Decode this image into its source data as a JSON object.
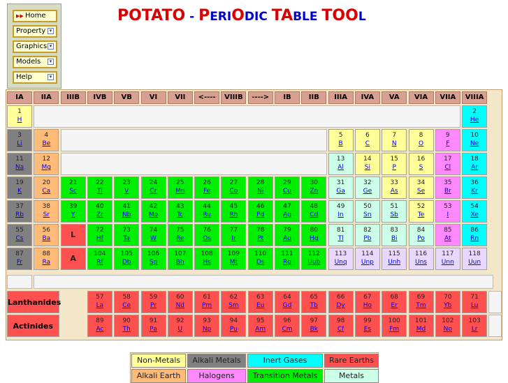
{
  "menu": {
    "home": "Home",
    "items": [
      "Property",
      "Graphics",
      "Models",
      "Help"
    ]
  },
  "title": [
    {
      "t": "POTATO",
      "c": "r",
      "big": true
    },
    {
      "t": " - ",
      "c": "b"
    },
    {
      "t": "P",
      "c": "r",
      "big": true
    },
    {
      "t": "ERI",
      "c": "b"
    },
    {
      "t": "O",
      "c": "r",
      "big": true
    },
    {
      "t": "DIC ",
      "c": "b"
    },
    {
      "t": "TA",
      "c": "r",
      "big": true
    },
    {
      "t": "BLE ",
      "c": "b"
    },
    {
      "t": "TOO",
      "c": "r",
      "big": true
    },
    {
      "t": "L",
      "c": "b"
    }
  ],
  "headers": [
    "IA",
    "IIA",
    "IIIB",
    "IVB",
    "VB",
    "VI",
    "VII",
    "<----",
    "VIIIB",
    "---->",
    "IB",
    "IIB",
    "IIIA",
    "IVA",
    "VA",
    "VIA",
    "VIIA",
    "VIIIA"
  ],
  "colors": {
    "nm": "#ffff99",
    "am": "#808080",
    "ig": "#00ffff",
    "re": "#ff5050",
    "ae": "#ffbb77",
    "ha": "#ff88ff",
    "tm": "#00ee00",
    "me": "#ccffe8",
    "ta": "#ffeedd",
    "rs": "#e8d8ff"
  },
  "main": [
    [
      1,
      "H",
      1,
      0,
      "nm"
    ],
    [
      2,
      "He",
      18,
      0,
      "ig"
    ],
    [
      3,
      "Li",
      1,
      1,
      "am"
    ],
    [
      4,
      "Be",
      2,
      1,
      "ae"
    ],
    [
      5,
      "B",
      13,
      1,
      "nm"
    ],
    [
      6,
      "C",
      14,
      1,
      "nm"
    ],
    [
      7,
      "N",
      15,
      1,
      "nm"
    ],
    [
      8,
      "O",
      16,
      1,
      "nm"
    ],
    [
      9,
      "F",
      17,
      1,
      "ha"
    ],
    [
      10,
      "Ne",
      18,
      1,
      "ig"
    ],
    [
      11,
      "Na",
      1,
      2,
      "am"
    ],
    [
      12,
      "Mg",
      2,
      2,
      "ae"
    ],
    [
      13,
      "Al",
      13,
      2,
      "me"
    ],
    [
      14,
      "Si",
      14,
      2,
      "nm"
    ],
    [
      15,
      "P",
      15,
      2,
      "nm"
    ],
    [
      16,
      "S",
      16,
      2,
      "nm"
    ],
    [
      17,
      "Cl",
      17,
      2,
      "ha"
    ],
    [
      18,
      "Ar",
      18,
      2,
      "ig"
    ],
    [
      19,
      "K",
      1,
      3,
      "am"
    ],
    [
      20,
      "Ca",
      2,
      3,
      "ae"
    ],
    [
      21,
      "Sc",
      3,
      3,
      "tm"
    ],
    [
      22,
      "Ti",
      4,
      3,
      "tm"
    ],
    [
      23,
      "V",
      5,
      3,
      "tm"
    ],
    [
      24,
      "Cr",
      6,
      3,
      "tm"
    ],
    [
      25,
      "Mn",
      7,
      3,
      "tm"
    ],
    [
      26,
      "Fe",
      8,
      3,
      "tm"
    ],
    [
      27,
      "Co",
      9,
      3,
      "tm"
    ],
    [
      28,
      "Ni",
      10,
      3,
      "tm"
    ],
    [
      29,
      "Cu",
      11,
      3,
      "tm"
    ],
    [
      30,
      "Zn",
      12,
      3,
      "tm"
    ],
    [
      31,
      "Ga",
      13,
      3,
      "me"
    ],
    [
      32,
      "Ge",
      14,
      3,
      "me"
    ],
    [
      33,
      "As",
      15,
      3,
      "nm"
    ],
    [
      34,
      "Se",
      16,
      3,
      "nm"
    ],
    [
      35,
      "Br",
      17,
      3,
      "ha"
    ],
    [
      36,
      "Kr",
      18,
      3,
      "ig"
    ],
    [
      37,
      "Rb",
      1,
      4,
      "am"
    ],
    [
      38,
      "Sr",
      2,
      4,
      "ae"
    ],
    [
      39,
      "Y",
      3,
      4,
      "tm"
    ],
    [
      40,
      "Zr",
      4,
      4,
      "tm"
    ],
    [
      41,
      "Nb",
      5,
      4,
      "tm"
    ],
    [
      42,
      "Mo",
      6,
      4,
      "tm"
    ],
    [
      43,
      "Tc",
      7,
      4,
      "tm"
    ],
    [
      44,
      "Ru",
      8,
      4,
      "tm"
    ],
    [
      45,
      "Rh",
      9,
      4,
      "tm"
    ],
    [
      46,
      "Pd",
      10,
      4,
      "tm"
    ],
    [
      47,
      "Ag",
      11,
      4,
      "tm"
    ],
    [
      48,
      "Cd",
      12,
      4,
      "tm"
    ],
    [
      49,
      "In",
      13,
      4,
      "me"
    ],
    [
      50,
      "Sn",
      14,
      4,
      "me"
    ],
    [
      51,
      "Sb",
      15,
      4,
      "me"
    ],
    [
      52,
      "Te",
      16,
      4,
      "nm"
    ],
    [
      53,
      "I",
      17,
      4,
      "ha"
    ],
    [
      54,
      "Xe",
      18,
      4,
      "ig"
    ],
    [
      55,
      "Cs",
      1,
      5,
      "am"
    ],
    [
      56,
      "Ba",
      2,
      5,
      "ae"
    ],
    [
      72,
      "Hf",
      4,
      5,
      "tm"
    ],
    [
      73,
      "Ta",
      5,
      5,
      "tm"
    ],
    [
      74,
      "W",
      6,
      5,
      "tm"
    ],
    [
      75,
      "Re",
      7,
      5,
      "tm"
    ],
    [
      76,
      "Os",
      8,
      5,
      "tm"
    ],
    [
      77,
      "Ir",
      9,
      5,
      "tm"
    ],
    [
      78,
      "Pt",
      10,
      5,
      "tm"
    ],
    [
      79,
      "Au",
      11,
      5,
      "tm"
    ],
    [
      80,
      "Hg",
      12,
      5,
      "tm"
    ],
    [
      81,
      "Tl",
      13,
      5,
      "me"
    ],
    [
      82,
      "Pb",
      14,
      5,
      "me"
    ],
    [
      83,
      "Bi",
      15,
      5,
      "me"
    ],
    [
      84,
      "Po",
      16,
      5,
      "me"
    ],
    [
      85,
      "At",
      17,
      5,
      "ha"
    ],
    [
      86,
      "Rn",
      18,
      5,
      "ig"
    ],
    [
      87,
      "Fr",
      1,
      6,
      "am"
    ],
    [
      88,
      "Ra",
      2,
      6,
      "ae"
    ],
    [
      104,
      "Rf",
      4,
      6,
      "tm"
    ],
    [
      105,
      "Db",
      5,
      6,
      "tm"
    ],
    [
      106,
      "Sg",
      6,
      6,
      "tm"
    ],
    [
      107,
      "Bh",
      7,
      6,
      "tm"
    ],
    [
      108,
      "Hs",
      8,
      6,
      "tm"
    ],
    [
      109,
      "Mt",
      9,
      6,
      "tm"
    ],
    [
      110,
      "Ds",
      10,
      6,
      "tm"
    ],
    [
      111,
      "Rg",
      11,
      6,
      "tm"
    ],
    [
      112,
      "Uub",
      12,
      6,
      "tm"
    ],
    [
      113,
      "Unq",
      13,
      6,
      "rs"
    ],
    [
      114,
      "Unp",
      14,
      6,
      "rs"
    ],
    [
      115,
      "Unh",
      15,
      6,
      "rs"
    ],
    [
      116,
      "Uns",
      16,
      6,
      "rs"
    ],
    [
      117,
      "Unn",
      17,
      6,
      "rs"
    ],
    [
      118,
      "Uun",
      18,
      6,
      "rs"
    ]
  ],
  "series_markers": [
    {
      "label": "L",
      "row": 5
    },
    {
      "label": "A",
      "row": 6
    }
  ],
  "lanthanides": {
    "label": "Lanthanides",
    "els": [
      [
        57,
        "La"
      ],
      [
        58,
        "Ce"
      ],
      [
        59,
        "Pr"
      ],
      [
        60,
        "Nd"
      ],
      [
        61,
        "Pm"
      ],
      [
        62,
        "Sm"
      ],
      [
        63,
        "Eu"
      ],
      [
        64,
        "Gd"
      ],
      [
        65,
        "Tb"
      ],
      [
        66,
        "Dy"
      ],
      [
        67,
        "Ho"
      ],
      [
        68,
        "Er"
      ],
      [
        69,
        "Tm"
      ],
      [
        70,
        "Yb"
      ],
      [
        71,
        "Lu"
      ]
    ]
  },
  "actinides": {
    "label": "Actinides",
    "els": [
      [
        89,
        "Ac"
      ],
      [
        90,
        "Th"
      ],
      [
        91,
        "Pa"
      ],
      [
        92,
        "U"
      ],
      [
        93,
        "Np"
      ],
      [
        94,
        "Pu"
      ],
      [
        95,
        "Am"
      ],
      [
        96,
        "Cm"
      ],
      [
        97,
        "Bk"
      ],
      [
        98,
        "Cf"
      ],
      [
        99,
        "Es"
      ],
      [
        100,
        "Fm"
      ],
      [
        101,
        "Md"
      ],
      [
        102,
        "No"
      ],
      [
        103,
        "Lr"
      ]
    ]
  },
  "legend": [
    [
      {
        "label": "Non-Metals",
        "c": "nm"
      },
      {
        "label": "Alkali Metals",
        "c": "am"
      },
      {
        "label": "Inert Gases",
        "c": "ig"
      },
      {
        "label": "Rare Earths",
        "c": "re"
      }
    ],
    [
      {
        "label": "Alkali Earth",
        "c": "ae"
      },
      {
        "label": "Halogens",
        "c": "ha"
      },
      {
        "label": "Transition Metals",
        "c": "tm"
      },
      {
        "label": "Metals",
        "c": "me"
      }
    ]
  ]
}
